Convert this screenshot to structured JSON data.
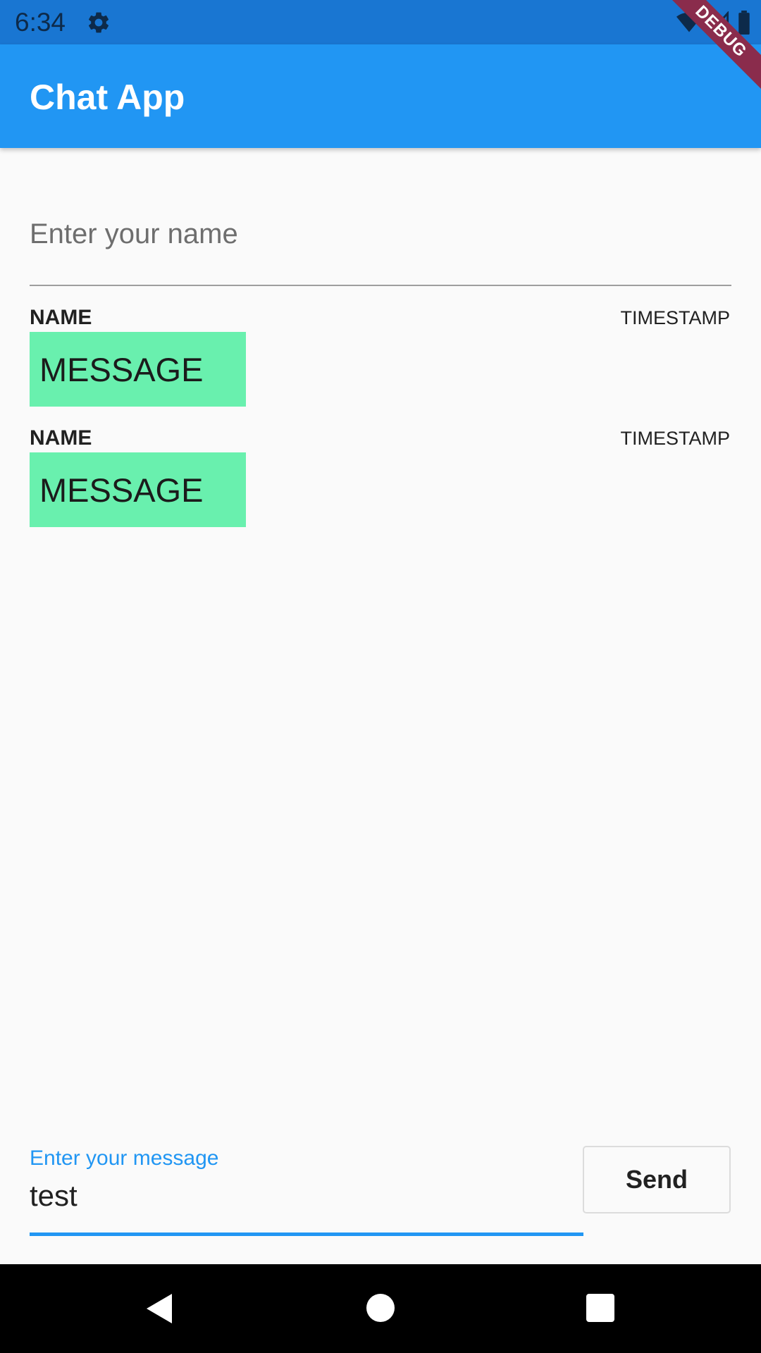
{
  "status_bar": {
    "time": "6:34",
    "icons": [
      "settings-gear-icon",
      "wifi-icon",
      "signal-icon",
      "battery-icon"
    ]
  },
  "app_bar": {
    "title": "Chat App",
    "color": "#2196F3"
  },
  "debug_banner": {
    "label": "DEBUG"
  },
  "name_field": {
    "placeholder": "Enter your name",
    "value": ""
  },
  "messages": [
    {
      "name": "NAME",
      "timestamp": "TIMESTAMP",
      "text": "MESSAGE"
    },
    {
      "name": "NAME",
      "timestamp": "TIMESTAMP",
      "text": "MESSAGE"
    }
  ],
  "message_field": {
    "label": "Enter your message",
    "value": "test"
  },
  "send_button": {
    "label": "Send"
  },
  "nav_bar": {
    "buttons": [
      "back-icon",
      "home-icon",
      "recents-icon"
    ]
  },
  "colors": {
    "primary": "#2196F3",
    "status_bar": "#1976D2",
    "bubble": "#69F0AE",
    "debug": "#8A2C4C"
  }
}
